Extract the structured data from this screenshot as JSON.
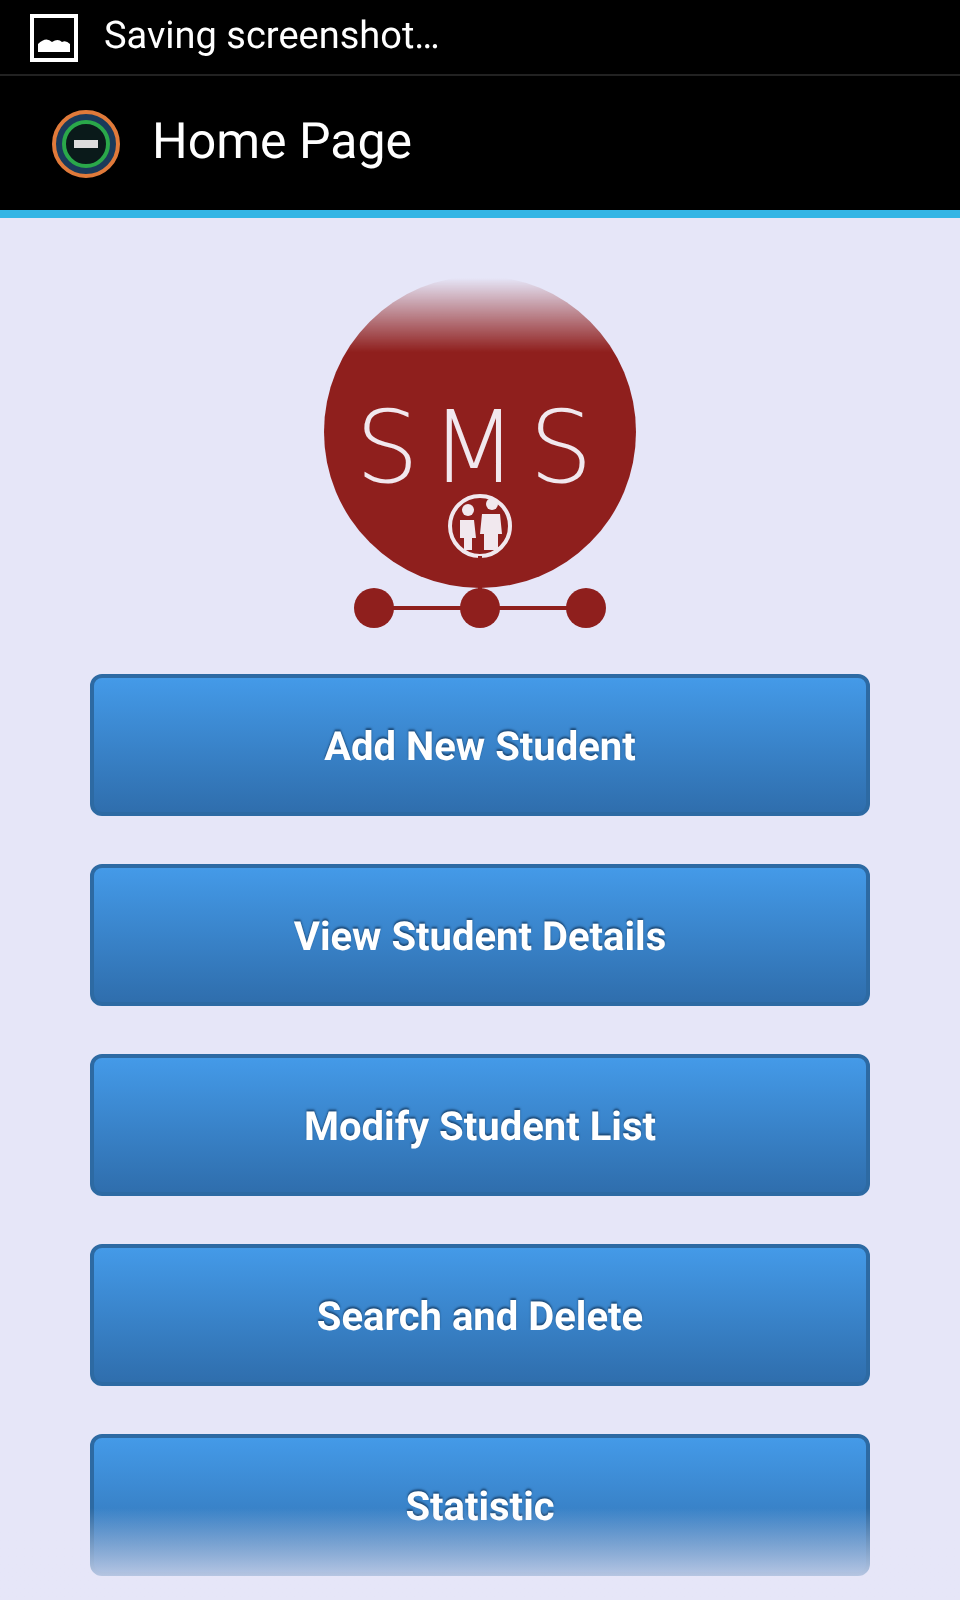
{
  "status_bar": {
    "notification": "Saving screenshot…"
  },
  "action_bar": {
    "title": "Home Page"
  },
  "logo": {
    "text": "SMS"
  },
  "buttons": [
    {
      "label": "Add New Student"
    },
    {
      "label": "View Student Details"
    },
    {
      "label": "Modify Student List"
    },
    {
      "label": "Search and Delete"
    },
    {
      "label": "Statistic"
    }
  ]
}
